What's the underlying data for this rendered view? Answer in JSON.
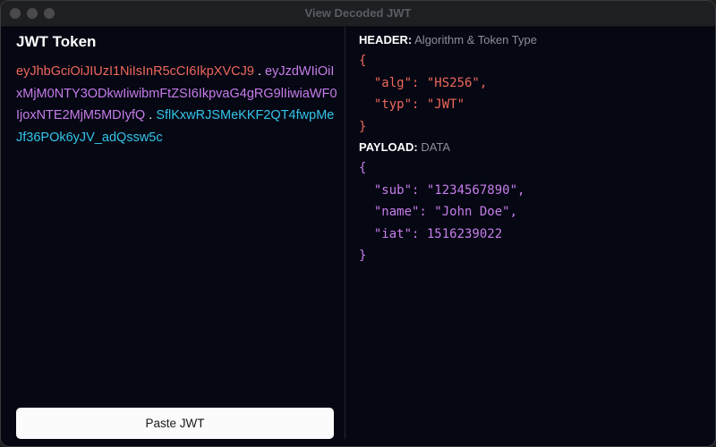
{
  "window": {
    "title": "View Decoded JWT"
  },
  "left": {
    "heading": "JWT Token",
    "token": {
      "header": "eyJhbGciOiJIUzI1NiIsInR5cCI6IkpXVCJ9",
      "payload": "eyJzdWIiOiIxMjM0NTY3ODkwIiwibmFtZSI6IkpvaG4gRG9lIiwiaWF0IjoxNTE2MjM5MDIyfQ",
      "signature": "SflKxwRJSMeKKF2QT4fwpMeJf36POk6yJV_adQssw5c",
      "separator": "."
    },
    "paste_button": "Paste JWT"
  },
  "right": {
    "header": {
      "label": "HEADER:",
      "sublabel": "Algorithm & Token Type",
      "json": "{\n  \"alg\": \"HS256\",\n  \"typ\": \"JWT\"\n}"
    },
    "payload": {
      "label": "PAYLOAD:",
      "sublabel": "DATA",
      "json": "{\n  \"sub\": \"1234567890\",\n  \"name\": \"John Doe\",\n  \"iat\": 1516239022\n}"
    }
  },
  "colors": {
    "header": "#f0685c",
    "payload": "#c77dea",
    "signature": "#34c5ea",
    "background": "#050713"
  }
}
